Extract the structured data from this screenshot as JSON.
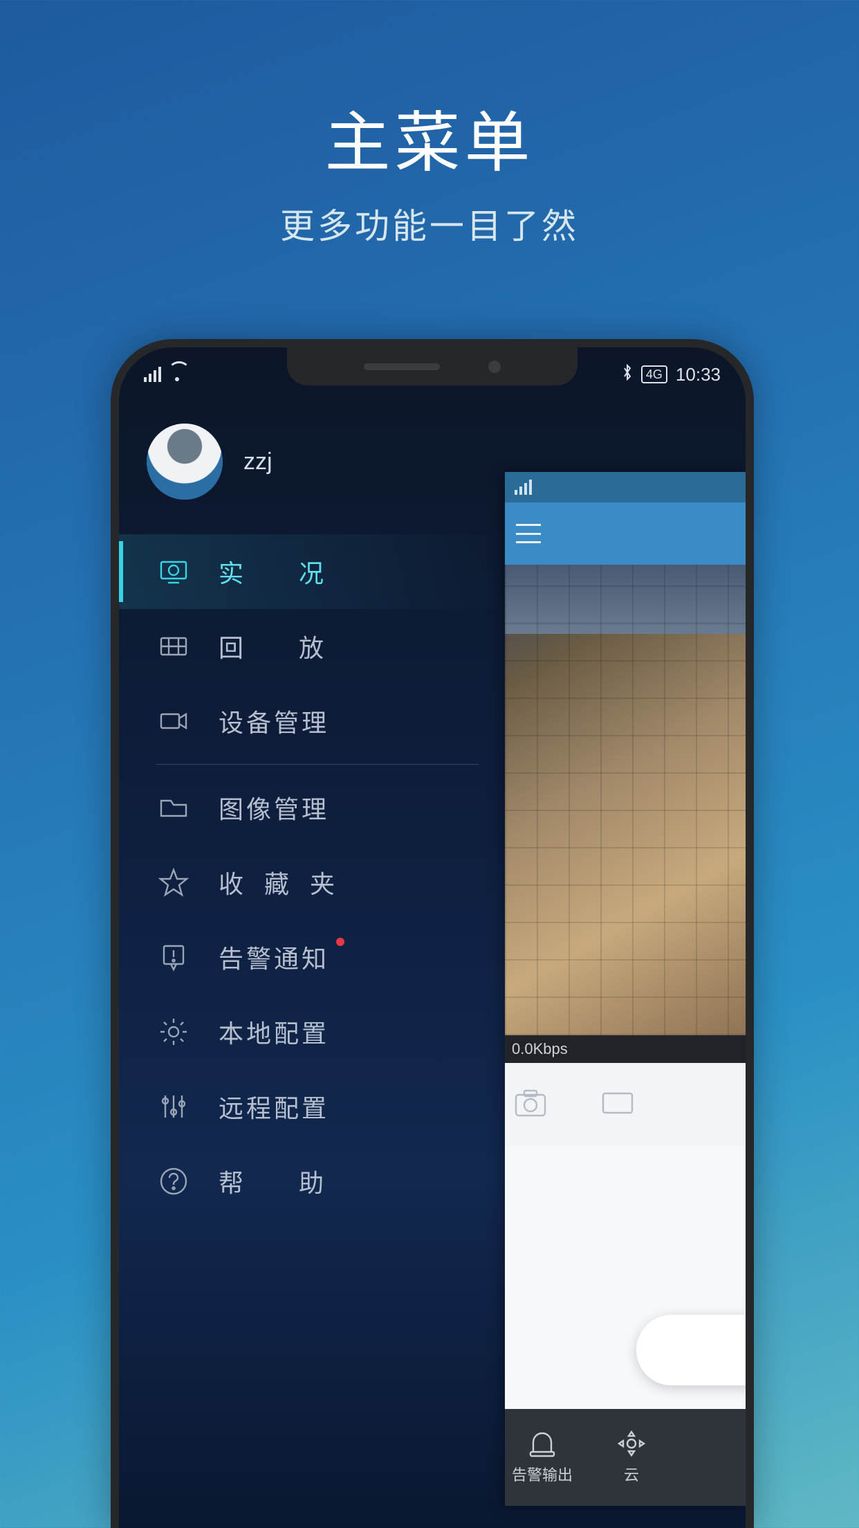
{
  "promo": {
    "title": "主菜单",
    "subtitle": "更多功能一目了然"
  },
  "statusbar": {
    "network_badge": "4G",
    "time": "10:33"
  },
  "profile": {
    "username": "zzj"
  },
  "menu": {
    "items": [
      {
        "key": "live",
        "label": "实　况",
        "icon": "monitor-icon",
        "active": true,
        "spacing": "wide",
        "badge": false
      },
      {
        "key": "playback",
        "label": "回　放",
        "icon": "film-icon",
        "active": false,
        "spacing": "wide",
        "badge": false
      },
      {
        "key": "devices",
        "label": "设备管理",
        "icon": "camera-icon",
        "active": false,
        "spacing": "tight",
        "badge": false
      },
      {
        "_divider": true
      },
      {
        "key": "images",
        "label": "图像管理",
        "icon": "folder-icon",
        "active": false,
        "spacing": "tight",
        "badge": false
      },
      {
        "key": "fav",
        "label": "收 藏 夹",
        "icon": "star-icon",
        "active": false,
        "spacing": "half",
        "badge": false
      },
      {
        "key": "alarm",
        "label": "告警通知",
        "icon": "alert-icon",
        "active": false,
        "spacing": "tight",
        "badge": true
      },
      {
        "key": "local",
        "label": "本地配置",
        "icon": "gear-icon",
        "active": false,
        "spacing": "tight",
        "badge": false
      },
      {
        "key": "remote",
        "label": "远程配置",
        "icon": "sliders-icon",
        "active": false,
        "spacing": "tight",
        "badge": false
      },
      {
        "key": "help",
        "label": "帮　助",
        "icon": "help-icon",
        "active": false,
        "spacing": "wide",
        "badge": false
      }
    ]
  },
  "preview": {
    "bitrate": "0.0Kbps",
    "bottom_tabs": [
      {
        "key": "alarm-out",
        "label": "告警输出"
      },
      {
        "key": "ptz",
        "label": "云"
      }
    ]
  }
}
